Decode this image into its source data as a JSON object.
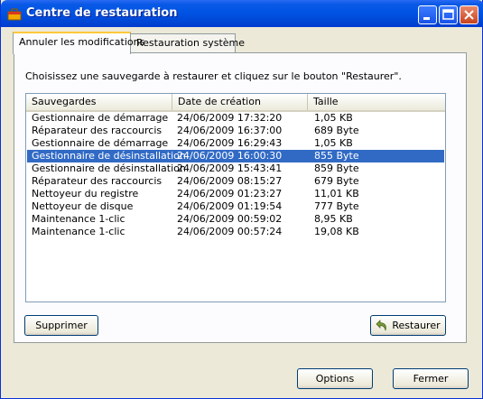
{
  "window": {
    "title": "Centre de restauration"
  },
  "tabs": [
    {
      "label": "Annuler les modifications",
      "active": true
    },
    {
      "label": "Restauration système",
      "active": false
    }
  ],
  "instructions": "Choisissez une sauvegarde à restaurer et cliquez sur le bouton \"Restaurer\".",
  "list": {
    "columns": [
      "Sauvegardes",
      "Date de création",
      "Taille"
    ],
    "rows": [
      {
        "name": "Gestionnaire de démarrage",
        "date": "24/06/2009 17:32:20",
        "size": "1,05 KB"
      },
      {
        "name": "Réparateur des raccourcis",
        "date": "24/06/2009 16:37:00",
        "size": "689 Byte"
      },
      {
        "name": "Gestionnaire de démarrage",
        "date": "24/06/2009 16:29:43",
        "size": "1,05 KB"
      },
      {
        "name": "Gestionnaire de désinstallation",
        "date": "24/06/2009 16:00:30",
        "size": "855 Byte",
        "selected": true
      },
      {
        "name": "Gestionnaire de désinstallation",
        "date": "24/06/2009 15:43:41",
        "size": "859 Byte"
      },
      {
        "name": "Réparateur des raccourcis",
        "date": "24/06/2009 08:15:27",
        "size": "679 Byte"
      },
      {
        "name": "Nettoyeur du registre",
        "date": "24/06/2009 01:23:27",
        "size": "11,01 KB"
      },
      {
        "name": "Nettoyeur de disque",
        "date": "24/06/2009 01:19:54",
        "size": "777 Byte"
      },
      {
        "name": "Maintenance 1-clic",
        "date": "24/06/2009 00:59:02",
        "size": "8,95 KB"
      },
      {
        "name": "Maintenance 1-clic",
        "date": "24/06/2009 00:57:24",
        "size": "19,08 KB"
      }
    ]
  },
  "buttons": {
    "delete": "Supprimer",
    "restore": "Restaurer",
    "options": "Options",
    "close": "Fermer"
  },
  "icons": {
    "app": "toolbox-icon",
    "restore": "undo-arrow-icon"
  },
  "colors": {
    "titlebar": "#0054e3",
    "selection": "#316ac5",
    "active_tab_accent": "#ffc83c"
  }
}
